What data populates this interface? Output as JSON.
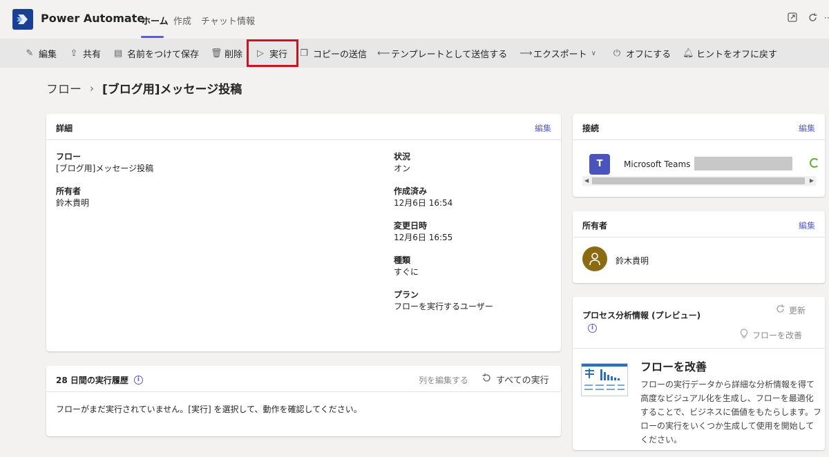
{
  "app": {
    "title": "Power Automate",
    "tabs": [
      {
        "label": "ホーム",
        "active": true
      },
      {
        "label": "作成"
      },
      {
        "label": "チャット"
      },
      {
        "label": "情報"
      }
    ],
    "icons": [
      "popout-icon",
      "refresh-icon",
      "more-icon"
    ]
  },
  "commands": [
    {
      "label": "編集",
      "icon": "pencil-icon"
    },
    {
      "label": "共有",
      "icon": "share-icon"
    },
    {
      "label": "名前をつけて保存",
      "icon": "save-as-icon"
    },
    {
      "label": "削除",
      "icon": "trash-icon"
    },
    {
      "label": "実行",
      "icon": "play-icon"
    },
    {
      "label": "コピーの送信",
      "icon": "copy-icon"
    },
    {
      "label": "テンプレートとして送信する",
      "icon": "arrow-left-icon"
    },
    {
      "label": "エクスポート",
      "icon": "arrow-right-icon"
    },
    {
      "label": "オフにする",
      "icon": "power-icon"
    },
    {
      "label": "ヒントをオフに戻す",
      "icon": "bell-icon"
    }
  ],
  "breadcrumb": {
    "root": "フロー",
    "current": "[ブログ用]メッセージ投稿"
  },
  "details": {
    "title": "詳細",
    "edit": "編集",
    "fields": {
      "flow_label": "フロー",
      "flow_value": "[ブログ用]メッセージ投稿",
      "owner_label": "所有者",
      "owner_value": "鈴木貴明",
      "status_label": "状況",
      "status_value": "オン",
      "created_label": "作成済み",
      "created_value": "12月6日 16:54",
      "modified_label": "変更日時",
      "modified_value": "12月6日 16:55",
      "type_label": "種類",
      "type_value": "すぐに",
      "plan_label": "プラン",
      "plan_value": "フローを実行するユーザー"
    }
  },
  "history": {
    "title": "28 日間の実行履歴",
    "edit_columns": "列を編集する",
    "all_runs": "すべての実行",
    "empty_message": "フローがまだ実行されていません。[実行] を選択して、動作を確認してください。"
  },
  "connections": {
    "title": "接続",
    "edit": "編集",
    "items": [
      {
        "name": "Microsoft Teams"
      }
    ]
  },
  "owners": {
    "title": "所有者",
    "edit": "編集",
    "name": "鈴木貴明"
  },
  "process": {
    "title": "プロセス分析情報 (プレビュー)",
    "refresh": "更新",
    "improve_link": "フローを改善",
    "improve_title": "フローを改善",
    "improve_desc": "フローの実行データから詳細な分析情報を得て高度なビジュアル化を生成し、フローを最適化することで、ビジネスに価値をもたらします。フローの実行をいくつか生成して使用を開始してください。"
  },
  "colors": {
    "accent": "#5b5fc7",
    "highlight": "#d0121b",
    "brand": "#1b3f93"
  }
}
